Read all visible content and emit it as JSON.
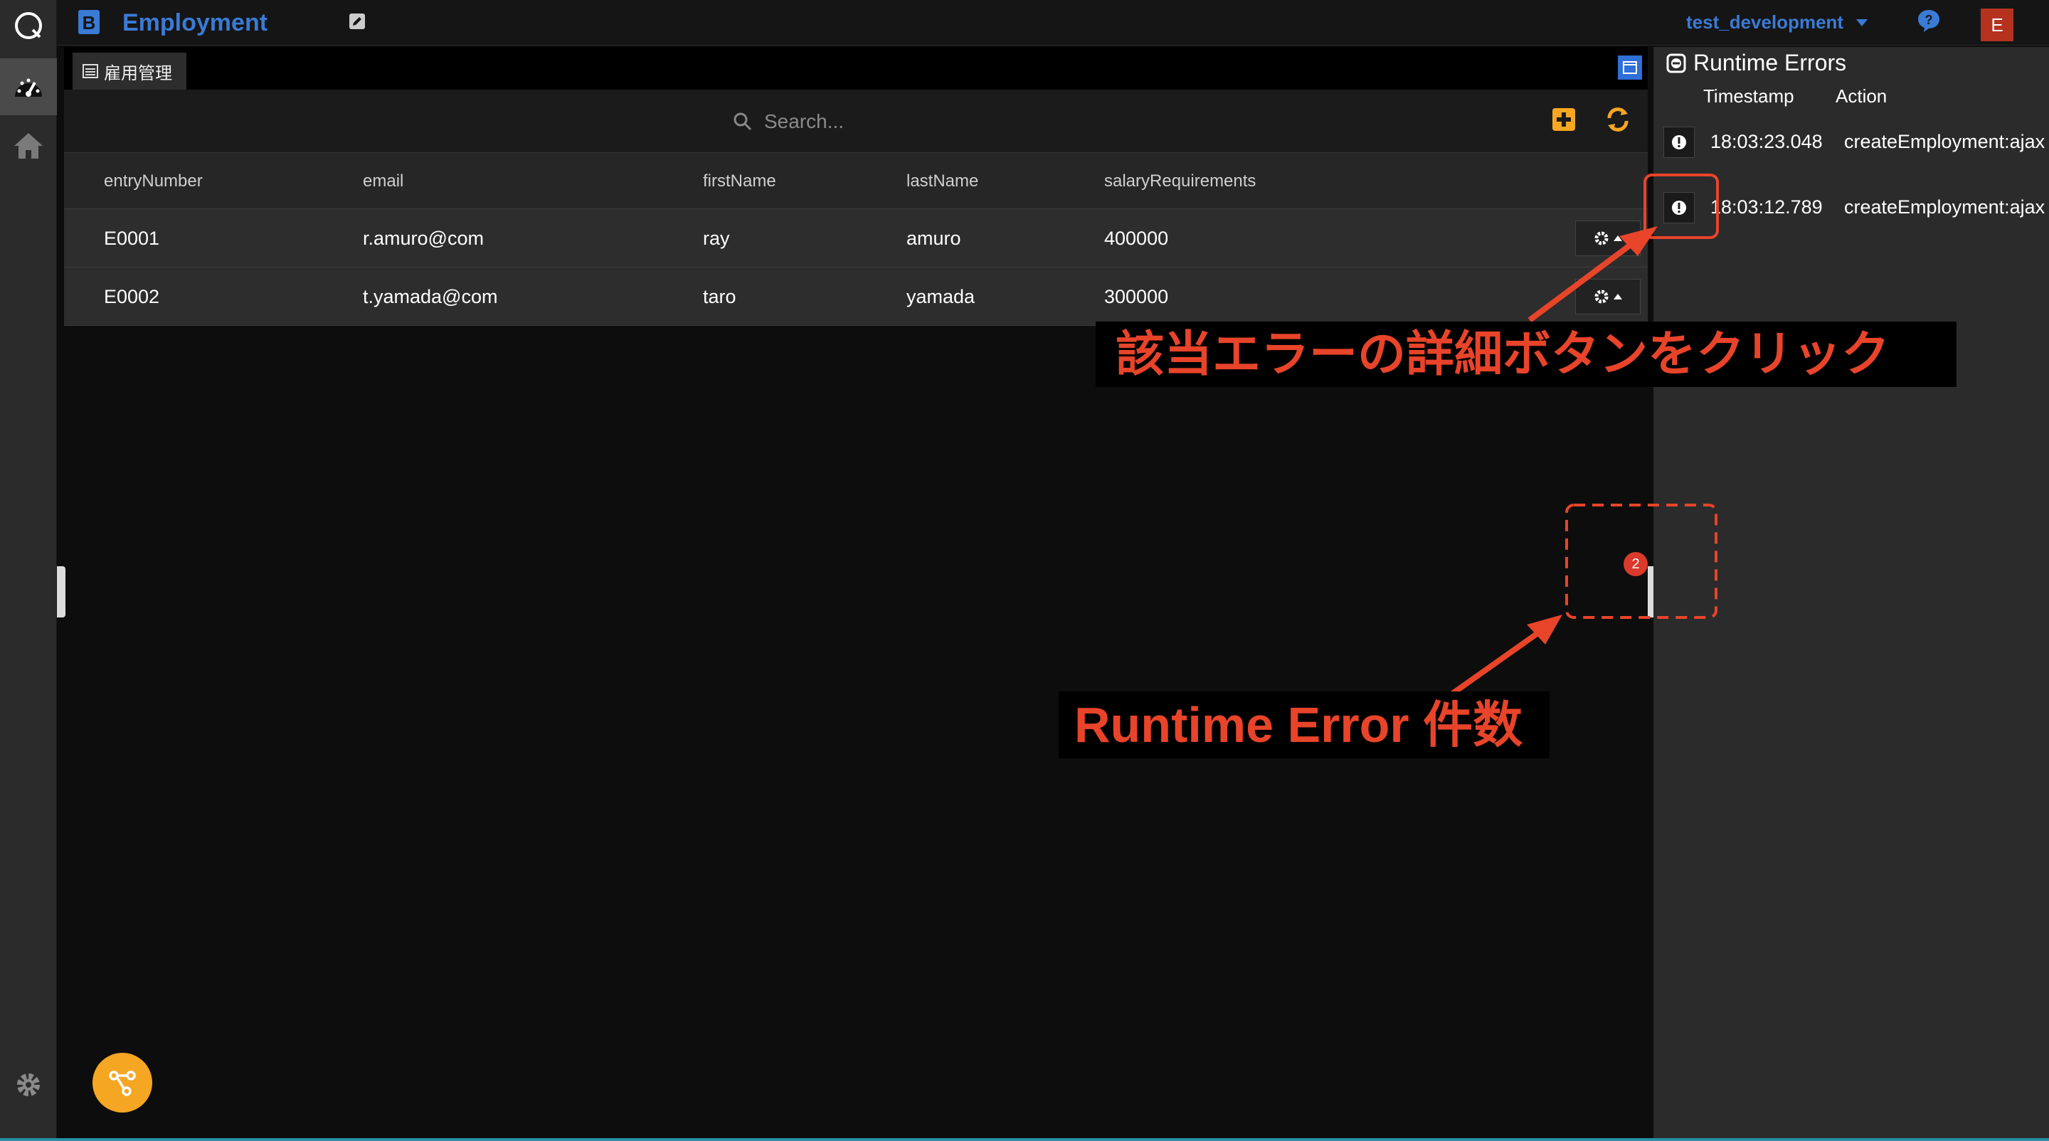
{
  "header": {
    "app_title": "Employment",
    "environment": "test_development",
    "avatar_initial": "E"
  },
  "tab": {
    "label": "雇用管理"
  },
  "search": {
    "placeholder": "Search..."
  },
  "table": {
    "columns": [
      "entryNumber",
      "email",
      "firstName",
      "lastName",
      "salaryRequirements"
    ],
    "rows": [
      [
        "E0001",
        "r.amuro@com",
        "ray",
        "amuro",
        "400000"
      ],
      [
        "E0002",
        "t.yamada@com",
        "taro",
        "yamada",
        "300000"
      ]
    ]
  },
  "errors_panel": {
    "title": "Runtime Errors",
    "columns": {
      "timestamp": "Timestamp",
      "action": "Action"
    },
    "rows": [
      {
        "timestamp": "18:03:23.048",
        "action": "createEmployment:ajax"
      },
      {
        "timestamp": "18:03:12.789",
        "action": "createEmployment:ajax"
      }
    ]
  },
  "error_count_badge": "2",
  "annotations": {
    "detail_button_callout": "該当エラーの詳細ボタンをクリック",
    "error_count_callout": "Runtime Error 件数"
  },
  "colors": {
    "accent_blue": "#3a7bd5",
    "annotation_red": "#e8442a",
    "orange": "#f5a623",
    "avatar_red": "#b5321f"
  }
}
